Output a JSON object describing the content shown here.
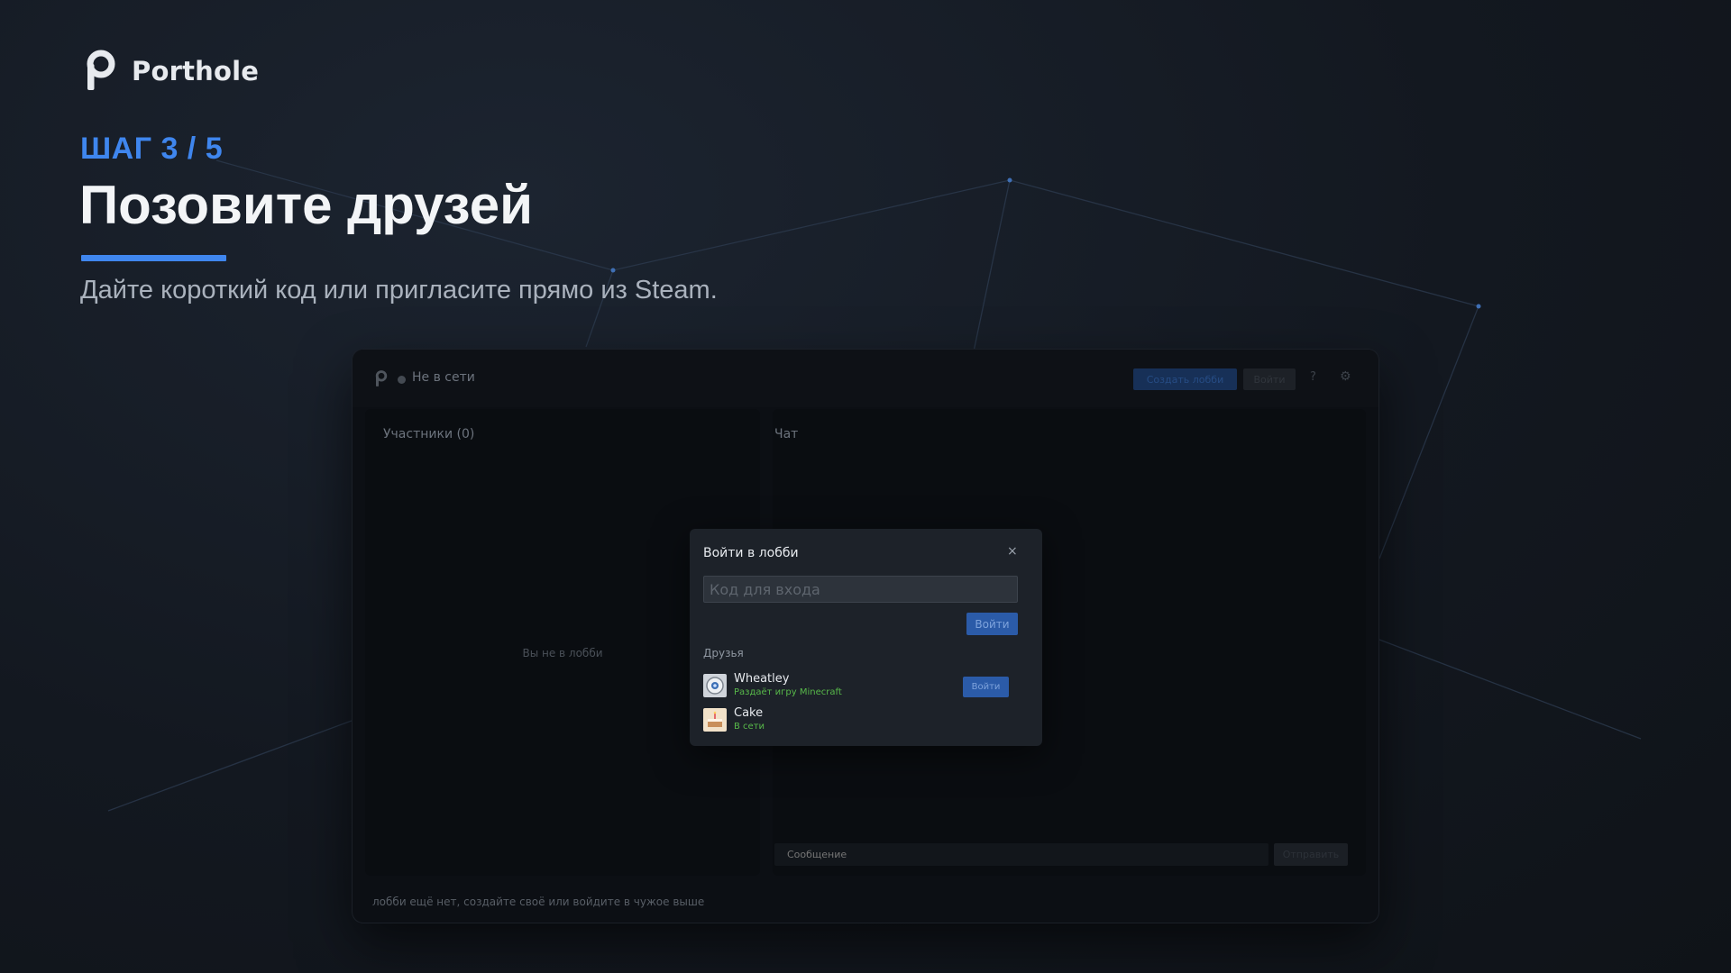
{
  "brand": {
    "name": "Porthole",
    "logo_icon": "porthole-logo-icon"
  },
  "onboarding": {
    "step": "ШАГ 3 / 5",
    "headline": "Позовите друзей",
    "subtitle": "Дайте короткий код или пригласите прямо из Steam.",
    "accent_color": "#3f86ee"
  },
  "app": {
    "status": "Не в сети",
    "toolbar": {
      "create_label": "Создать лобби",
      "join_label": "Войти",
      "help_label": "?",
      "settings_label": "⚙"
    },
    "members": {
      "title": "Участники (0)",
      "empty": "Вы не в лобби"
    },
    "chat": {
      "title": "Чат",
      "input_placeholder": "Сообщение",
      "send_label": "Отправить"
    },
    "footer": "лобби ещё нет, создайте своё или войдите в чужое выше"
  },
  "modal": {
    "title": "Войти в лобби",
    "close_label": "×",
    "code_placeholder": "Код для входа",
    "join_label": "Войти",
    "friends_title": "Друзья",
    "friends": [
      {
        "name": "Wheatley",
        "status": "Раздаёт игру Minecraft",
        "join_label": "Войти",
        "avatar": "wheatley-avatar"
      },
      {
        "name": "Cake",
        "status": "В сети",
        "avatar": "cake-avatar"
      }
    ],
    "status_color": "#58b94a"
  }
}
